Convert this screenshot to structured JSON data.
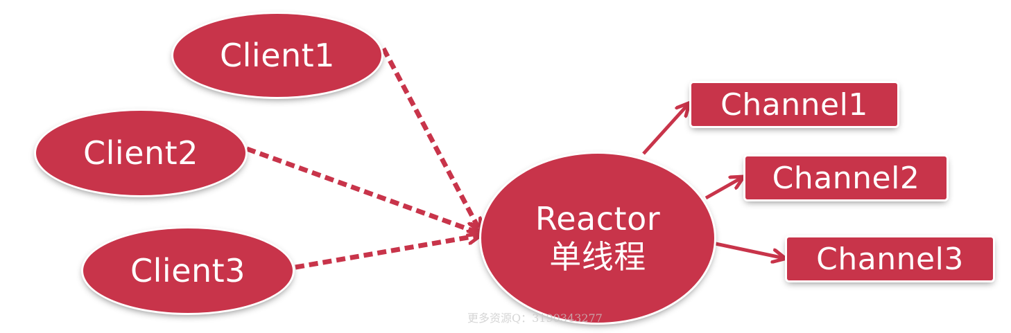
{
  "diagram": {
    "clients": [
      {
        "id": "client1",
        "label": "Client1"
      },
      {
        "id": "client2",
        "label": "Client2"
      },
      {
        "id": "client3",
        "label": "Client3"
      }
    ],
    "reactor": {
      "line1": "Reactor",
      "line2": "单线程"
    },
    "channels": [
      {
        "id": "channel1",
        "label": "Channel1"
      },
      {
        "id": "channel2",
        "label": "Channel2"
      },
      {
        "id": "channel3",
        "label": "Channel3"
      }
    ],
    "edges": [
      {
        "from": "client1",
        "to": "reactor",
        "style": "dashed"
      },
      {
        "from": "client2",
        "to": "reactor",
        "style": "dashed"
      },
      {
        "from": "client3",
        "to": "reactor",
        "style": "dashed"
      },
      {
        "from": "reactor",
        "to": "channel1",
        "style": "solid"
      },
      {
        "from": "reactor",
        "to": "channel2",
        "style": "solid"
      },
      {
        "from": "reactor",
        "to": "channel3",
        "style": "solid"
      }
    ]
  },
  "watermark": "更多资源Q：3190343277",
  "colors": {
    "node_fill": "#c8344a",
    "node_text": "#ffffff",
    "connector": "#c8344a",
    "background": "#ffffff"
  }
}
